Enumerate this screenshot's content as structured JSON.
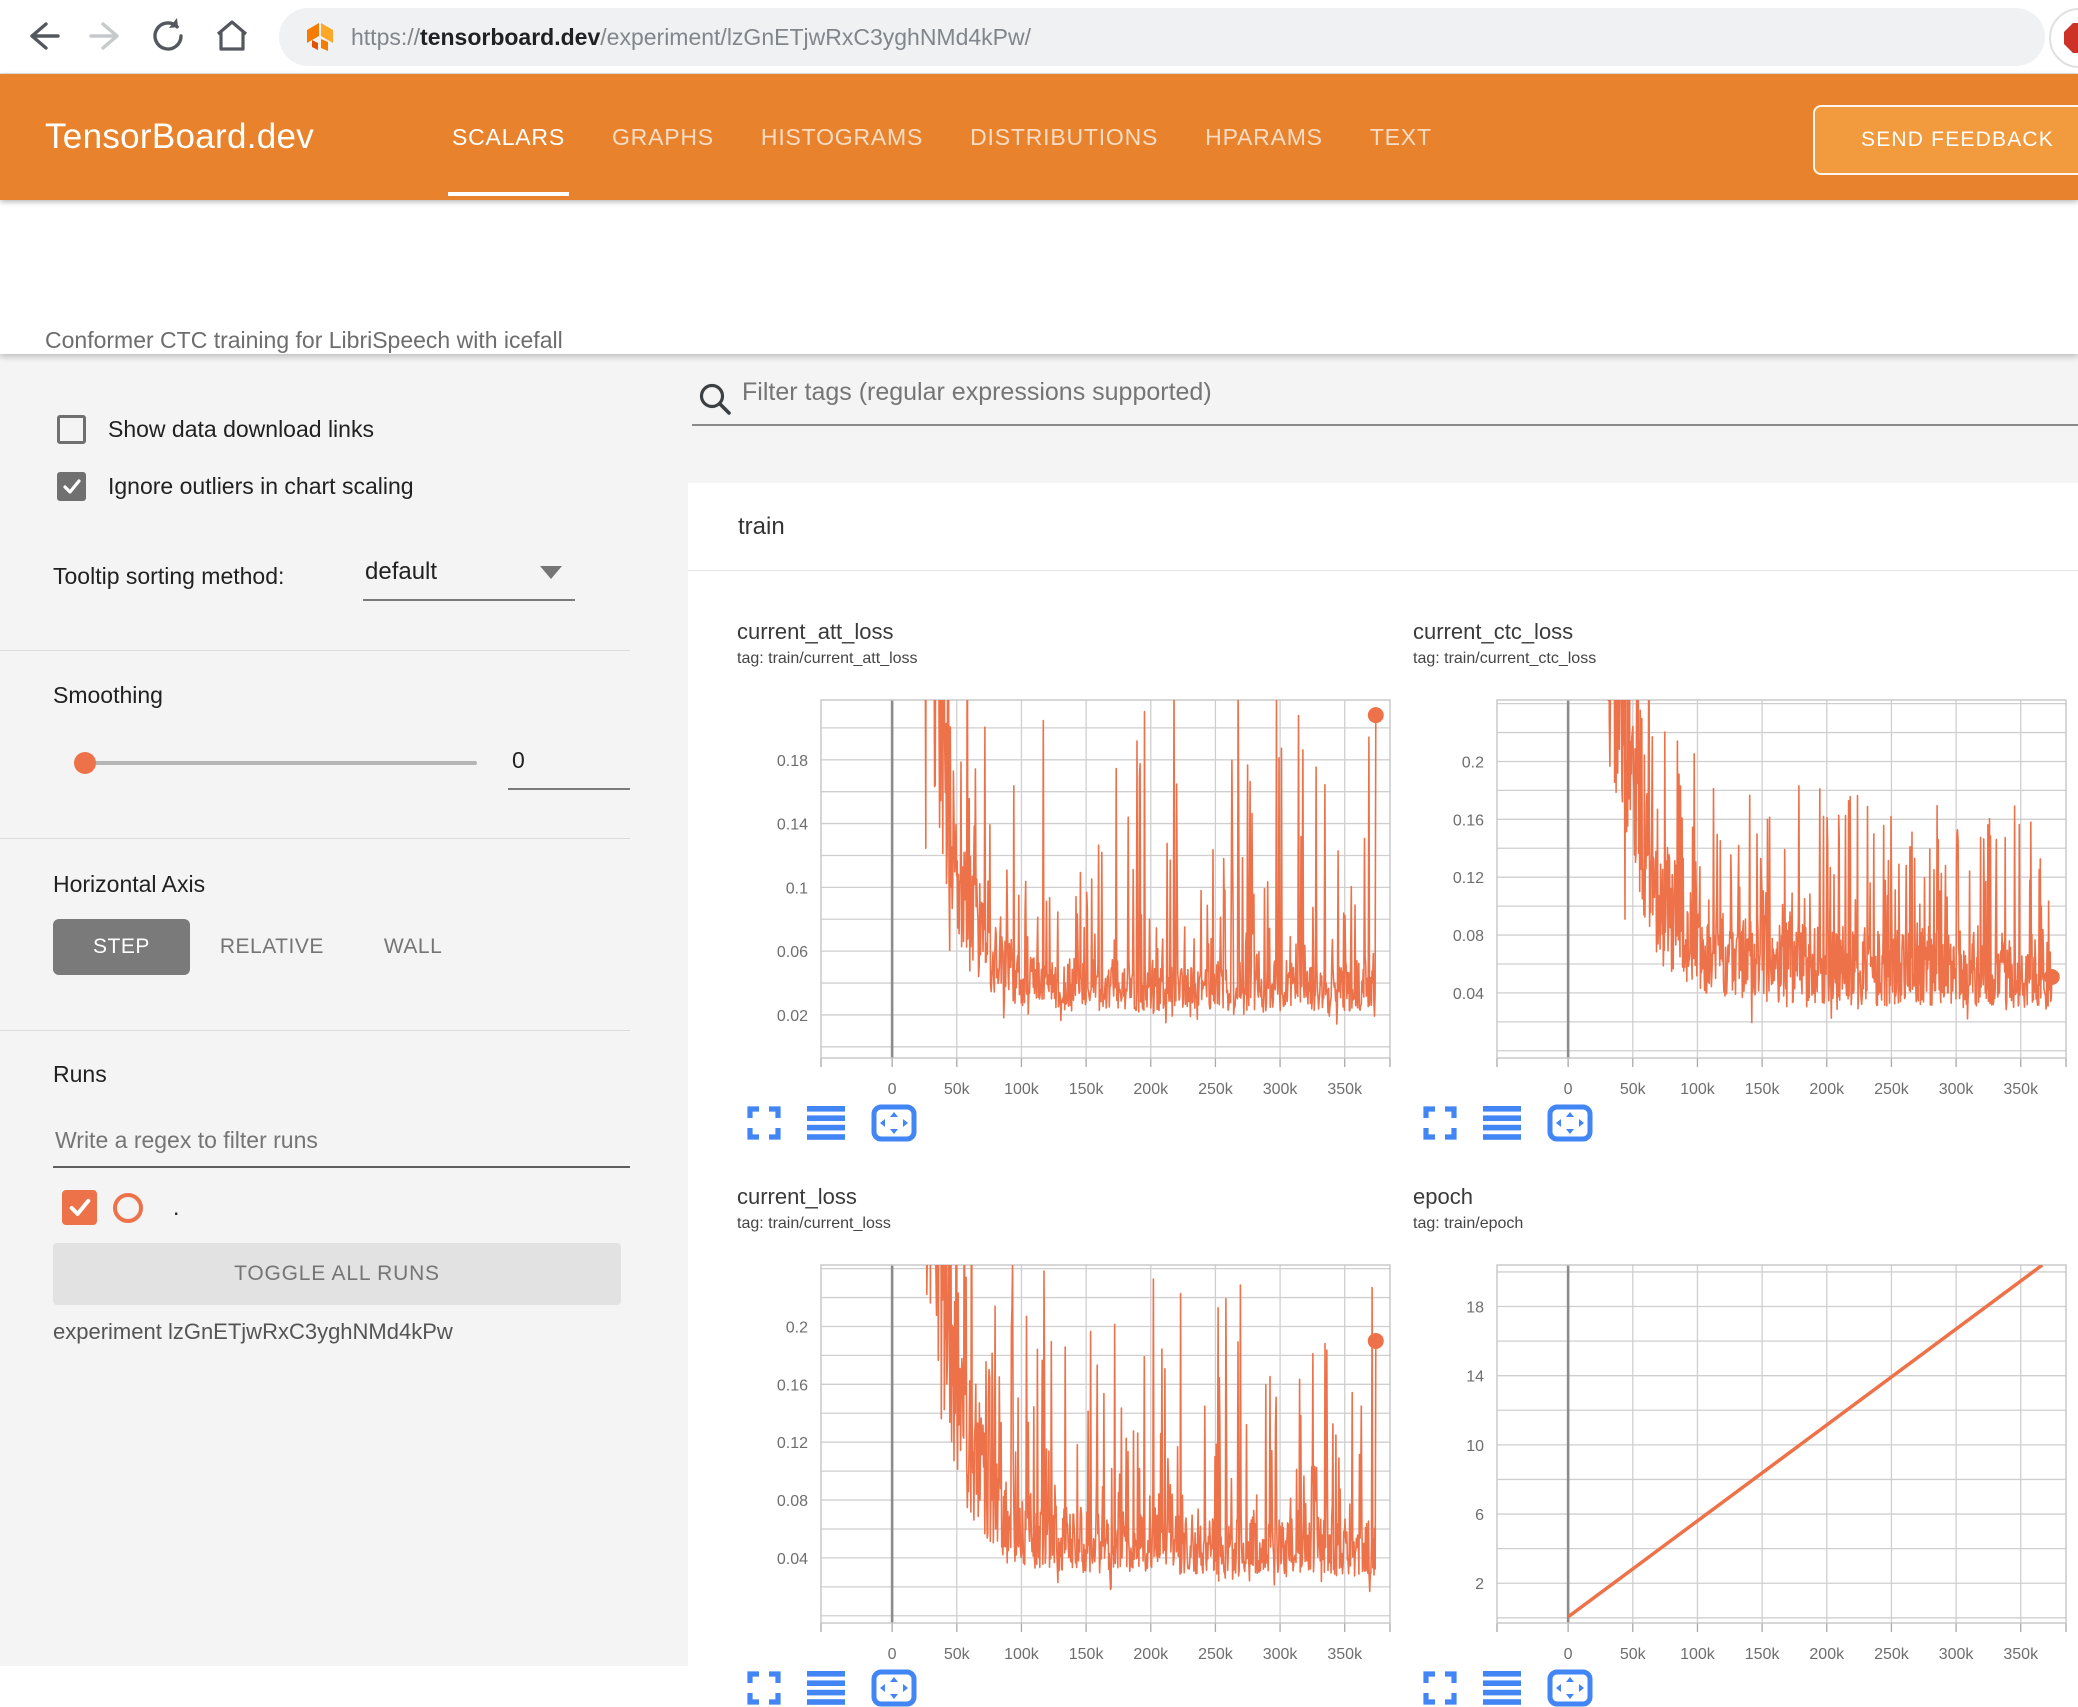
{
  "browser": {
    "url_prefix": "https://",
    "url_domain": "tensorboard.dev",
    "url_path": "/experiment/lzGnETjwRxC3yghNMd4kPw/",
    "icons": [
      "back-arrow",
      "forward-arrow",
      "reload",
      "home",
      "tensorboard-favicon",
      "adblock-extension"
    ]
  },
  "header": {
    "logo": "TensorBoard.dev",
    "tabs": [
      {
        "label": "SCALARS",
        "active": true
      },
      {
        "label": "GRAPHS",
        "active": false
      },
      {
        "label": "HISTOGRAMS",
        "active": false
      },
      {
        "label": "DISTRIBUTIONS",
        "active": false
      },
      {
        "label": "HPARAMS",
        "active": false
      },
      {
        "label": "TEXT",
        "active": false
      }
    ],
    "feedback_label": "SEND FEEDBACK"
  },
  "title_bar": {
    "experiment_title": "Conformer CTC training for LibriSpeech with icefall"
  },
  "sidebar": {
    "show_links_label": "Show data download links",
    "show_links_checked": false,
    "ignore_outliers_label": "Ignore outliers in chart scaling",
    "ignore_outliers_checked": true,
    "tooltip_label": "Tooltip sorting method:",
    "tooltip_value": "default",
    "smoothing_label": "Smoothing",
    "smoothing_value": "0",
    "horizontal_axis": {
      "label": "Horizontal Axis",
      "options": [
        "STEP",
        "RELATIVE",
        "WALL"
      ],
      "selected": "STEP"
    },
    "runs": {
      "label": "Runs",
      "filter_placeholder": "Write a regex to filter runs",
      "run_name": ".",
      "run_checked": true,
      "run_color": "#ee7249",
      "toggle_button": "TOGGLE ALL RUNS",
      "experiment_line": "experiment lzGnETjwRxC3yghNMd4kPw"
    }
  },
  "main": {
    "filter_placeholder": "Filter tags (regular expressions supported)",
    "group_label": "train"
  },
  "colors": {
    "header_orange": "#e8822c",
    "feedback_orange": "#f19a3e",
    "run_orange": "#ee7249",
    "icon_blue": "#4285f4",
    "grid": "#cfcfcf",
    "axis_dark": "#8c8c8c",
    "plot_border": "#c6c6c6"
  },
  "chart_data": [
    {
      "id": "current_att_loss",
      "type": "line",
      "title": "current_att_loss",
      "tag": "tag: train/current_att_loss",
      "col": 0,
      "row": 0,
      "x_axis": {
        "range": [
          -55000,
          385000
        ],
        "tick_values": [
          0,
          50000,
          100000,
          150000,
          200000,
          250000,
          300000,
          350000
        ],
        "tick_labels": [
          "0",
          "50k",
          "100k",
          "150k",
          "200k",
          "250k",
          "300k",
          "350k"
        ]
      },
      "y_axis": {
        "range": [
          -0.007,
          0.2175
        ],
        "grid_min": 0,
        "grid_max": 0.2,
        "grid_step": 0.02,
        "tick_values": [
          0.02,
          0.06,
          0.1,
          0.14,
          0.18
        ],
        "tick_labels": [
          "0.02",
          "0.06",
          "0.1",
          "0.14",
          "0.18"
        ]
      },
      "series": {
        "name": ".",
        "kind": "noisy-loss",
        "start_step": 10000,
        "end_step": 374000,
        "start_value": 0.75,
        "floor": 0.035,
        "floor_extra": 0,
        "floor_tau": 1,
        "decay_tau": 18000,
        "noise": 0.45,
        "mid_spike_prob": 0.16,
        "mid_spike_gain": 2.0,
        "dip_prob": 0.07,
        "spike_prob": 0.07,
        "spike_add": 0.17,
        "final_value": 0.208,
        "seed": 7,
        "points": 750
      },
      "end_dot": true
    },
    {
      "id": "current_ctc_loss",
      "type": "line",
      "title": "current_ctc_loss",
      "tag": "tag: train/current_ctc_loss",
      "col": 1,
      "row": 0,
      "x_axis": {
        "range": [
          -55000,
          385000
        ],
        "tick_values": [
          0,
          50000,
          100000,
          150000,
          200000,
          250000,
          300000,
          350000
        ],
        "tick_labels": [
          "0",
          "50k",
          "100k",
          "150k",
          "200k",
          "250k",
          "300k",
          "350k"
        ]
      },
      "y_axis": {
        "range": [
          -0.005,
          0.2425
        ],
        "grid_min": 0,
        "grid_max": 0.24,
        "grid_step": 0.02,
        "tick_values": [
          0.04,
          0.08,
          0.12,
          0.16,
          0.2
        ],
        "tick_labels": [
          "0.04",
          "0.08",
          "0.12",
          "0.16",
          "0.2"
        ]
      },
      "series": {
        "name": ".",
        "kind": "noisy-loss",
        "start_step": 10000,
        "end_step": 374000,
        "start_value": 0.9,
        "floor": 0.048,
        "floor_extra": 0.025,
        "floor_tau": 120000,
        "decay_tau": 20000,
        "noise": 0.5,
        "mid_spike_prob": 0.2,
        "mid_spike_gain": 1.4,
        "dip_prob": 0.08,
        "spike_prob": 0.05,
        "spike_add": 0.1,
        "final_value": 0.051,
        "seed": 21,
        "points": 900
      },
      "end_dot": true
    },
    {
      "id": "current_loss",
      "type": "line",
      "title": "current_loss",
      "tag": "tag: train/current_loss",
      "col": 0,
      "row": 1,
      "x_axis": {
        "range": [
          -55000,
          385000
        ],
        "tick_values": [
          0,
          50000,
          100000,
          150000,
          200000,
          250000,
          300000,
          350000
        ],
        "tick_labels": [
          "0",
          "50k",
          "100k",
          "150k",
          "200k",
          "250k",
          "300k",
          "350k"
        ]
      },
      "y_axis": {
        "range": [
          -0.005,
          0.2425
        ],
        "grid_min": 0,
        "grid_max": 0.24,
        "grid_step": 0.02,
        "tick_values": [
          0.04,
          0.08,
          0.12,
          0.16,
          0.2
        ],
        "tick_labels": [
          "0.04",
          "0.08",
          "0.12",
          "0.16",
          "0.2"
        ]
      },
      "series": {
        "name": ".",
        "kind": "noisy-loss",
        "start_step": 10000,
        "end_step": 374000,
        "start_value": 0.85,
        "floor": 0.042,
        "floor_extra": 0.012,
        "floor_tau": 150000,
        "decay_tau": 19000,
        "noise": 0.45,
        "mid_spike_prob": 0.17,
        "mid_spike_gain": 1.9,
        "dip_prob": 0.07,
        "spike_prob": 0.06,
        "spike_add": 0.16,
        "final_value": 0.19,
        "seed": 33,
        "points": 780
      },
      "end_dot": true
    },
    {
      "id": "epoch",
      "type": "line",
      "title": "epoch",
      "tag": "tag: train/epoch",
      "col": 1,
      "row": 1,
      "x_axis": {
        "range": [
          -55000,
          385000
        ],
        "tick_values": [
          0,
          50000,
          100000,
          150000,
          200000,
          250000,
          300000,
          350000
        ],
        "tick_labels": [
          "0",
          "50k",
          "100k",
          "150k",
          "200k",
          "250k",
          "300k",
          "350k"
        ]
      },
      "y_axis": {
        "range": [
          -0.3,
          20.4
        ],
        "grid_min": 0,
        "grid_max": 20,
        "grid_step": 2,
        "tick_values": [
          2,
          6,
          10,
          14,
          18
        ],
        "tick_labels": [
          "2",
          "6",
          "10",
          "14",
          "18"
        ]
      },
      "series": {
        "name": ".",
        "kind": "linear",
        "points_xy": [
          [
            0,
            0.05
          ],
          [
            366700,
            20.4
          ]
        ],
        "slope_per_step": 5.55e-05
      },
      "end_dot": false
    }
  ]
}
